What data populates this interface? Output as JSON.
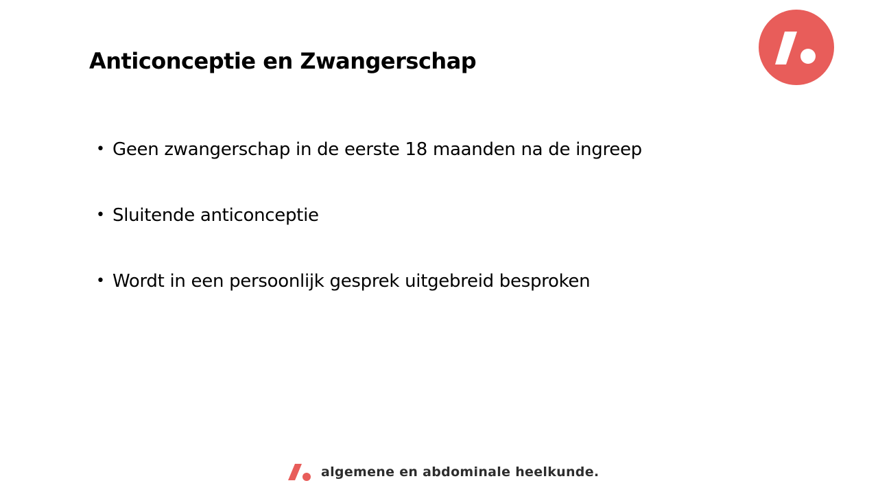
{
  "slide": {
    "title": "Anticonceptie en Zwangerschap",
    "bullets": [
      "Geen zwangerschap in de eerste 18 maanden na de ingreep",
      "Sluitende anticonceptie",
      "Wordt in een persoonlijk gesprek uitgebreid besproken"
    ],
    "bullet_glyph": "•"
  },
  "brand": {
    "logo_icon": "slash-dot-logo-icon",
    "footer_text": "algemene en abdominale  heelkunde.",
    "accent_color": "#E85D5A"
  }
}
